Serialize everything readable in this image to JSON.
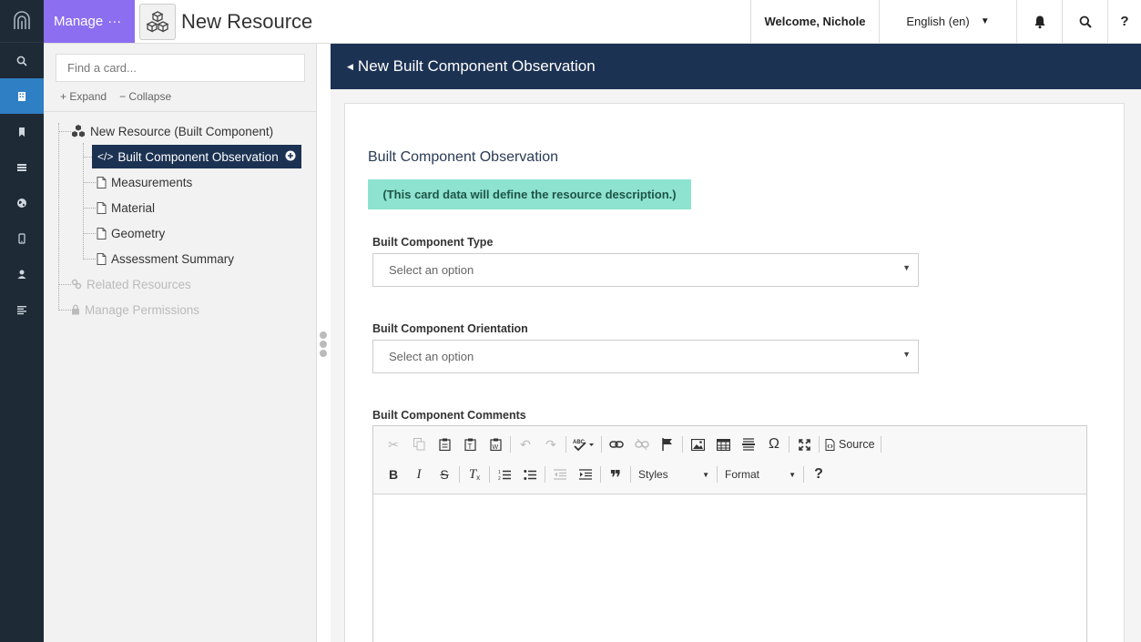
{
  "nav": {
    "items": [
      "search",
      "resource",
      "bookmark",
      "list",
      "globe",
      "mobile",
      "user",
      "notes"
    ]
  },
  "topbar": {
    "manage_label": "Manage",
    "manage_dots": "···",
    "resource_title": "New Resource",
    "welcome": "Welcome, Nichole",
    "language": "English (en)",
    "help": "?"
  },
  "tree": {
    "search_placeholder": "Find a card...",
    "expand_label": "Expand",
    "collapse_label": "Collapse",
    "root_label": "New Resource (Built Component)",
    "selected_label": "Built Component Observation",
    "children": [
      "Measurements",
      "Material",
      "Geometry",
      "Assessment Summary"
    ],
    "related_label": "Related Resources",
    "permissions_label": "Manage Permissions"
  },
  "main": {
    "header_title": "New Built Component Observation",
    "card_title": "Built Component Observation",
    "card_note": "(This card data will define the resource description.)",
    "field_type_label": "Built Component Type",
    "field_type_value": "Select an option",
    "field_orientation_label": "Built Component Orientation",
    "field_orientation_value": "Select an option",
    "field_comments_label": "Built Component Comments"
  },
  "editor": {
    "source_label": "Source",
    "styles_label": "Styles",
    "format_label": "Format",
    "help_label": "?"
  },
  "colors": {
    "rail": "#1e2a36",
    "rail_active": "#2f7fc4",
    "manage": "#8c6ff0",
    "header": "#1c3253",
    "note": "#8de3cf"
  }
}
